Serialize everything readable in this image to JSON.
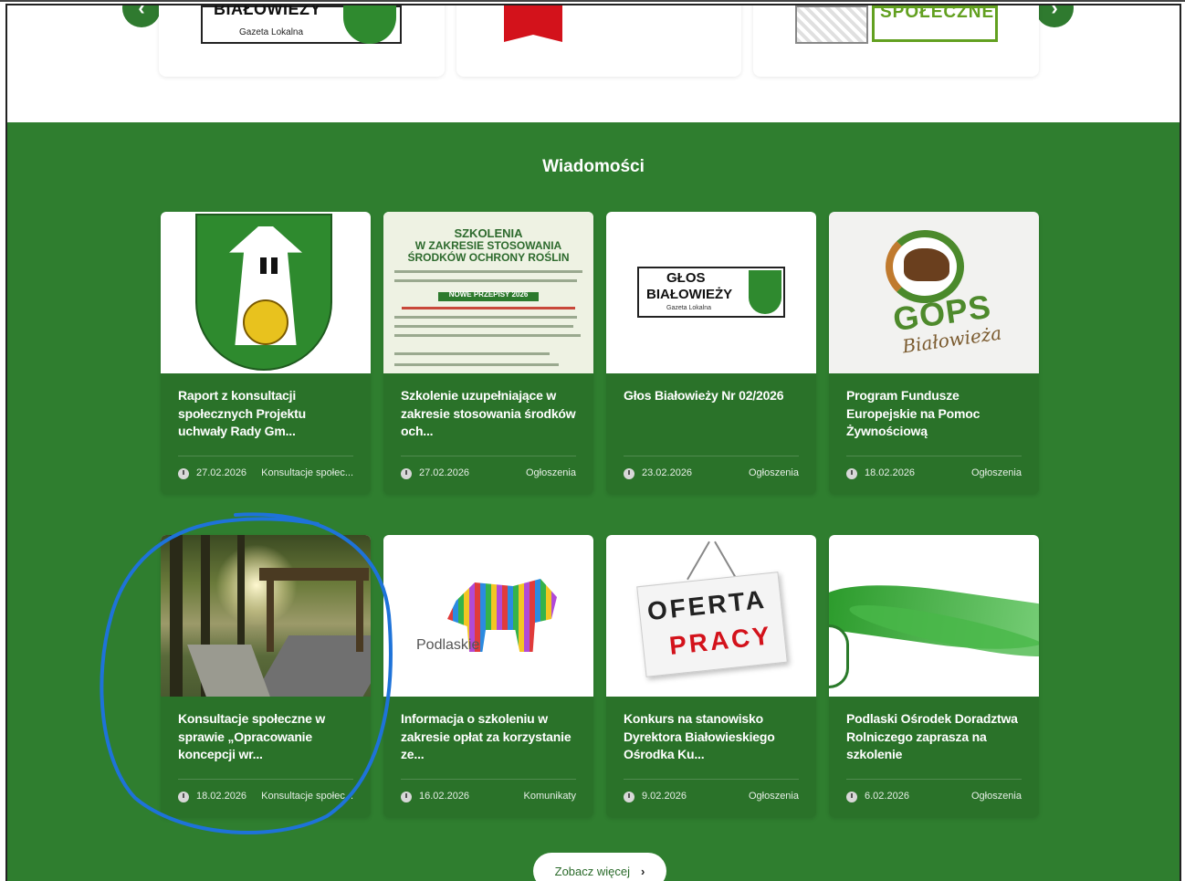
{
  "top_carousel": {
    "cards": [
      {
        "logo_title": "BIAŁOWIEŻY",
        "logo_sub": "Gazeta Lokalna"
      },
      {
        "logo_title": ""
      },
      {
        "logo_title": "SPOŁECZNE"
      }
    ]
  },
  "news": {
    "title": "Wiadomości",
    "items": [
      {
        "title": "Raport z konsultacji społecznych Projektu uchwały Rady Gm...",
        "date": "27.02.2026",
        "category": "Konsultacje społec..."
      },
      {
        "title": "Szkolenie uzupełniające w zakresie stosowania środków och...",
        "date": "27.02.2026",
        "category": "Ogłoszenia"
      },
      {
        "title": "Głos Białowieży Nr 02/2026",
        "date": "23.02.2026",
        "category": "Ogłoszenia"
      },
      {
        "title": "Program Fundusze Europejskie na Pomoc Żywnościową",
        "date": "18.02.2026",
        "category": "Ogłoszenia"
      },
      {
        "title": "Konsultacje społeczne w sprawie „Opracowanie koncepcji wr...",
        "date": "18.02.2026",
        "category": "Konsultacje społec..."
      },
      {
        "title": "Informacja o szkoleniu w zakresie opłat za korzystanie ze...",
        "date": "16.02.2026",
        "category": "Komunikaty"
      },
      {
        "title": "Konkurs na stanowisko Dyrektora Białowieskiego Ośrodka Ku...",
        "date": "9.02.2026",
        "category": "Ogłoszenia"
      },
      {
        "title": "Podlaski Ośrodek Doradztwa Rolniczego zaprasza na szkolenie",
        "date": "6.02.2026",
        "category": "Ogłoszenia"
      }
    ],
    "more_label": "Zobacz więcej"
  },
  "images": {
    "szkolenia": {
      "h1": "SZKOLENIA",
      "h2": "W ZAKRESIE STOSOWANIA",
      "h3": "ŚRODKÓW OCHRONY ROŚLIN",
      "band": "NOWE PRZEPISY 2026"
    },
    "glos": {
      "l1": "GŁOS",
      "l2": "BIAŁOWIEŻY",
      "l3": "Gazeta Lokalna"
    },
    "gops": {
      "l1": "GOPS",
      "l2": "Białowieża"
    },
    "podlaskie": "Podlaskie",
    "oferta": {
      "l1": "OFERTA",
      "l2": "PRACY"
    }
  },
  "colors": {
    "section_green": "#2f7e2f",
    "card_green": "#2a7229",
    "accent_annotation": "#1e73d9"
  }
}
